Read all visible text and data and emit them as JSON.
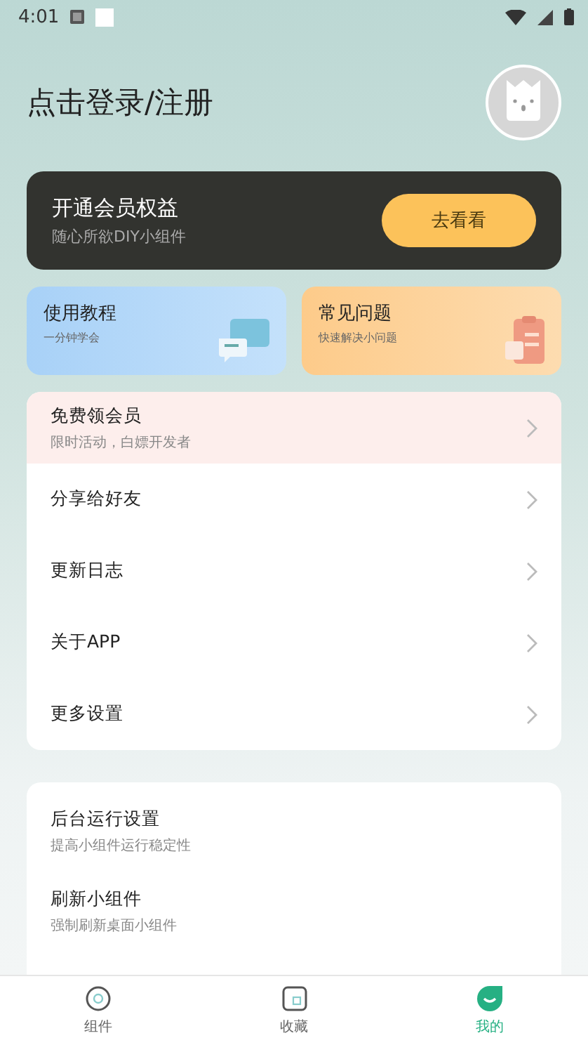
{
  "status_bar": {
    "time": "4:01"
  },
  "header": {
    "title": "点击登录/注册"
  },
  "vip_card": {
    "title": "开通会员权益",
    "subtitle": "随心所欲DIY小组件",
    "button": "去看看"
  },
  "quick_cards": [
    {
      "kind": "tutorial",
      "title": "使用教程",
      "subtitle": "一分钟学会"
    },
    {
      "kind": "faq",
      "title": "常见问题",
      "subtitle": "快速解决小问题"
    }
  ],
  "menu": [
    {
      "title": "免费领会员",
      "subtitle": "限时活动，白嫖开发者",
      "highlighted": true
    },
    {
      "title": "分享给好友",
      "highlighted": false
    },
    {
      "title": "更新日志",
      "highlighted": false
    },
    {
      "title": "关于APP",
      "highlighted": false
    },
    {
      "title": "更多设置",
      "highlighted": false
    }
  ],
  "settings": [
    {
      "title": "后台运行设置",
      "subtitle": "提高小组件运行稳定性"
    },
    {
      "title": "刷新小组件",
      "subtitle": "强制刷新桌面小组件"
    }
  ],
  "bottom_nav": [
    {
      "kind": "widgets",
      "label": "组件",
      "selected": false
    },
    {
      "kind": "favorites",
      "label": "收藏",
      "selected": false
    },
    {
      "kind": "mine",
      "label": "我的",
      "selected": true
    }
  ]
}
